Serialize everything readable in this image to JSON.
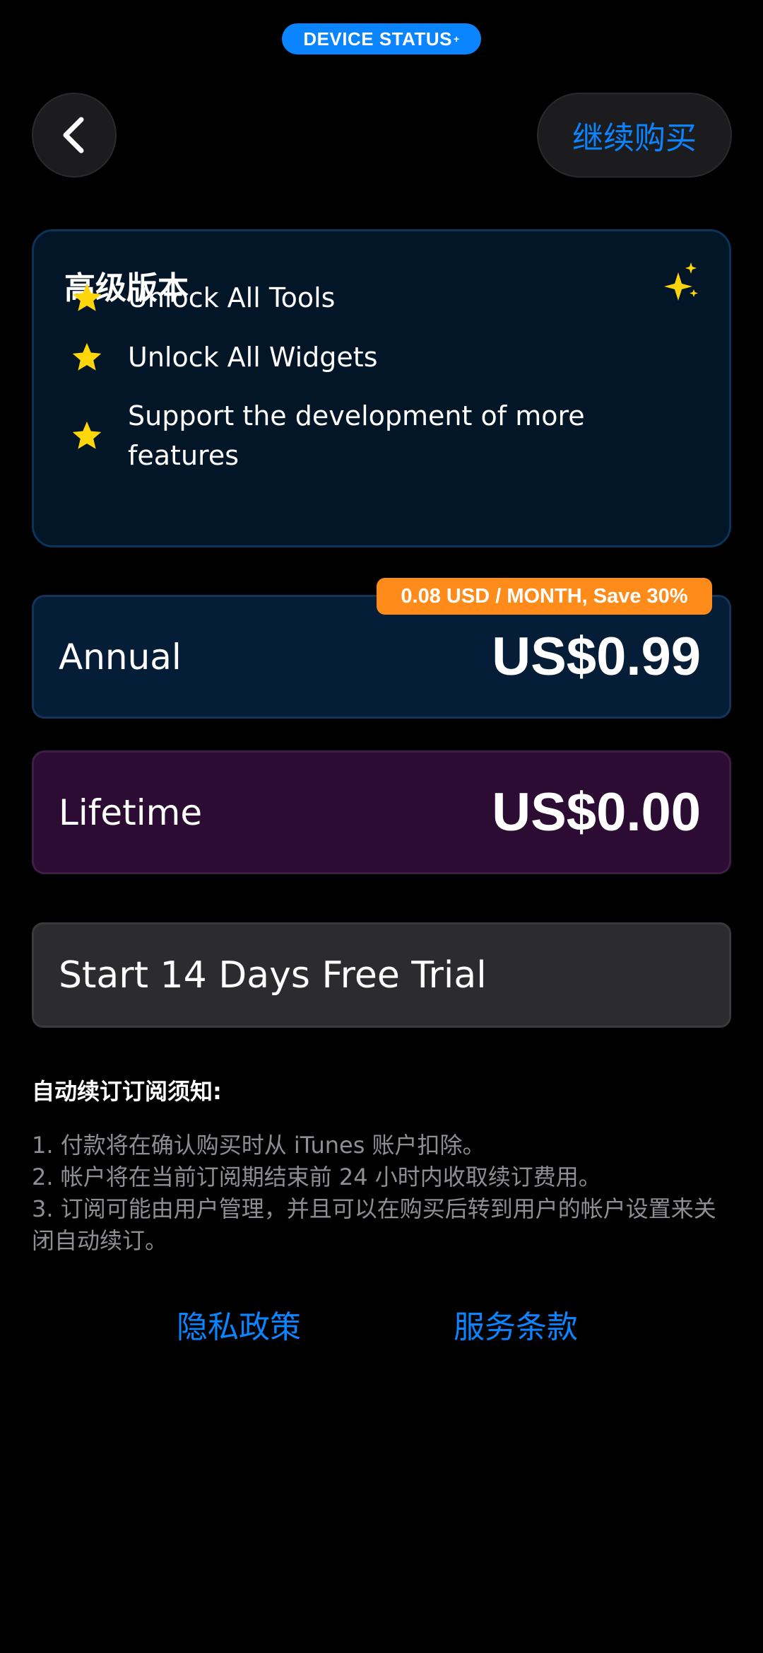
{
  "header": {
    "status_pill": "DEVICE STATUS",
    "status_pill_plus": "+",
    "continue_purchase": "继续购买"
  },
  "features": {
    "title": "高级版本",
    "items": [
      {
        "text": "Unlock All Tools"
      },
      {
        "text": "Unlock All Widgets"
      },
      {
        "text": "Support the development of more features"
      }
    ]
  },
  "plans": {
    "annual": {
      "name": "Annual",
      "price": "US$0.99",
      "badge": "0.08 USD / MONTH, Save 30%"
    },
    "lifetime": {
      "name": "Lifetime",
      "price": "US$0.00"
    }
  },
  "trial": {
    "label": "Start 14 Days Free Trial"
  },
  "notice": {
    "title": "自动续订订阅须知:",
    "items": [
      "1. 付款将在确认购买时从 iTunes 账户扣除。",
      "2. 帐户将在当前订阅期结束前 24 小时内收取续订费用。",
      "3. 订阅可能由用户管理，并且可以在购买后转到用户的帐户设置来关闭自动续订。"
    ]
  },
  "footer": {
    "privacy": "隐私政策",
    "terms": "服务条款"
  },
  "colors": {
    "accent": "#0a84ff",
    "badge": "#ff8c1a",
    "star": "#ffd60a",
    "annual_bg": "#061d38",
    "lifetime_bg": "#2c0c33"
  },
  "icons": {
    "back": "chevron-left-icon",
    "sparkle": "sparkles-icon",
    "star": "star-icon"
  }
}
